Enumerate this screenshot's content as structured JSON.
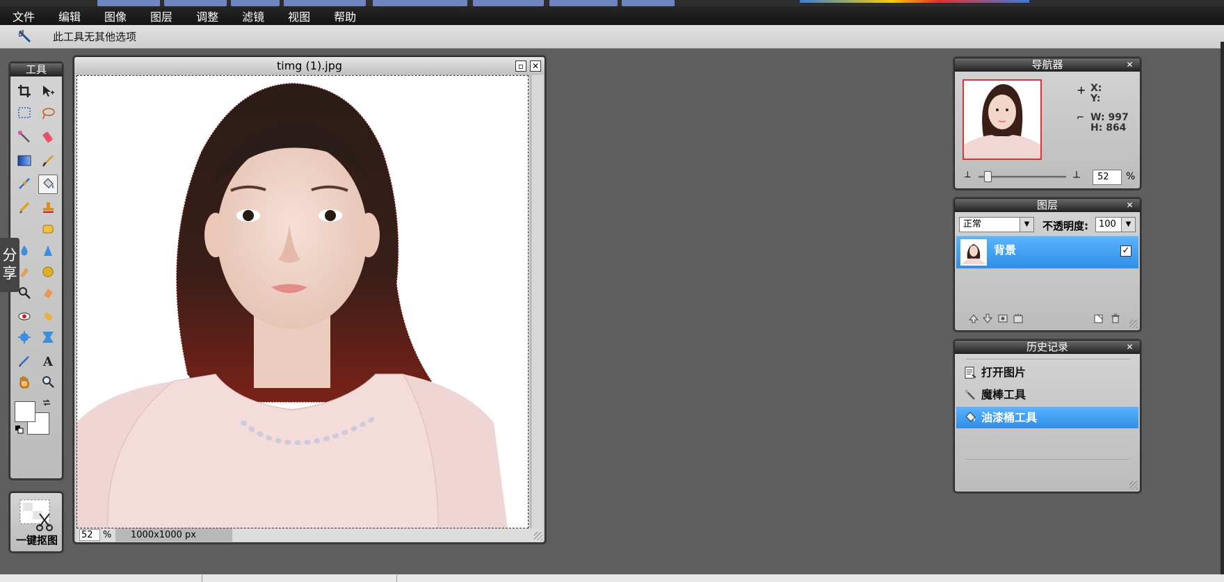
{
  "menu": [
    "文件",
    "编辑",
    "图像",
    "图层",
    "调整",
    "滤镜",
    "视图",
    "帮助"
  ],
  "options_bar": {
    "text": "此工具无其他选项"
  },
  "toolbox": {
    "title": "工具",
    "cutout_label": "一键抠图"
  },
  "share_tab": {
    "label": "分享"
  },
  "document": {
    "title": "timg (1).jpg",
    "zoom": "52",
    "zoom_unit": "%",
    "size": "1000x1000 px"
  },
  "navigator": {
    "title": "导航器",
    "x_label": "X:",
    "y_label": "Y:",
    "w_label": "W: 997",
    "h_label": "H: 864",
    "zoom": "52",
    "zoom_unit": "%"
  },
  "layers": {
    "title": "图层",
    "blend_mode": "正常",
    "opacity_label": "不透明度:",
    "opacity_value": "100",
    "items": [
      {
        "name": "背景",
        "visible": true
      }
    ]
  },
  "history": {
    "title": "历史记录",
    "items": [
      {
        "label": "打开图片",
        "icon": "open-image-icon",
        "selected": false
      },
      {
        "label": "魔棒工具",
        "icon": "magic-wand-icon",
        "selected": false
      },
      {
        "label": "油漆桶工具",
        "icon": "paint-bucket-icon",
        "selected": true
      }
    ]
  },
  "colors": {
    "panel_title_dark": "#202020",
    "selection_blue": "#2f8ee6",
    "workspace": "#5e5e5e",
    "menubar": "#141414"
  }
}
